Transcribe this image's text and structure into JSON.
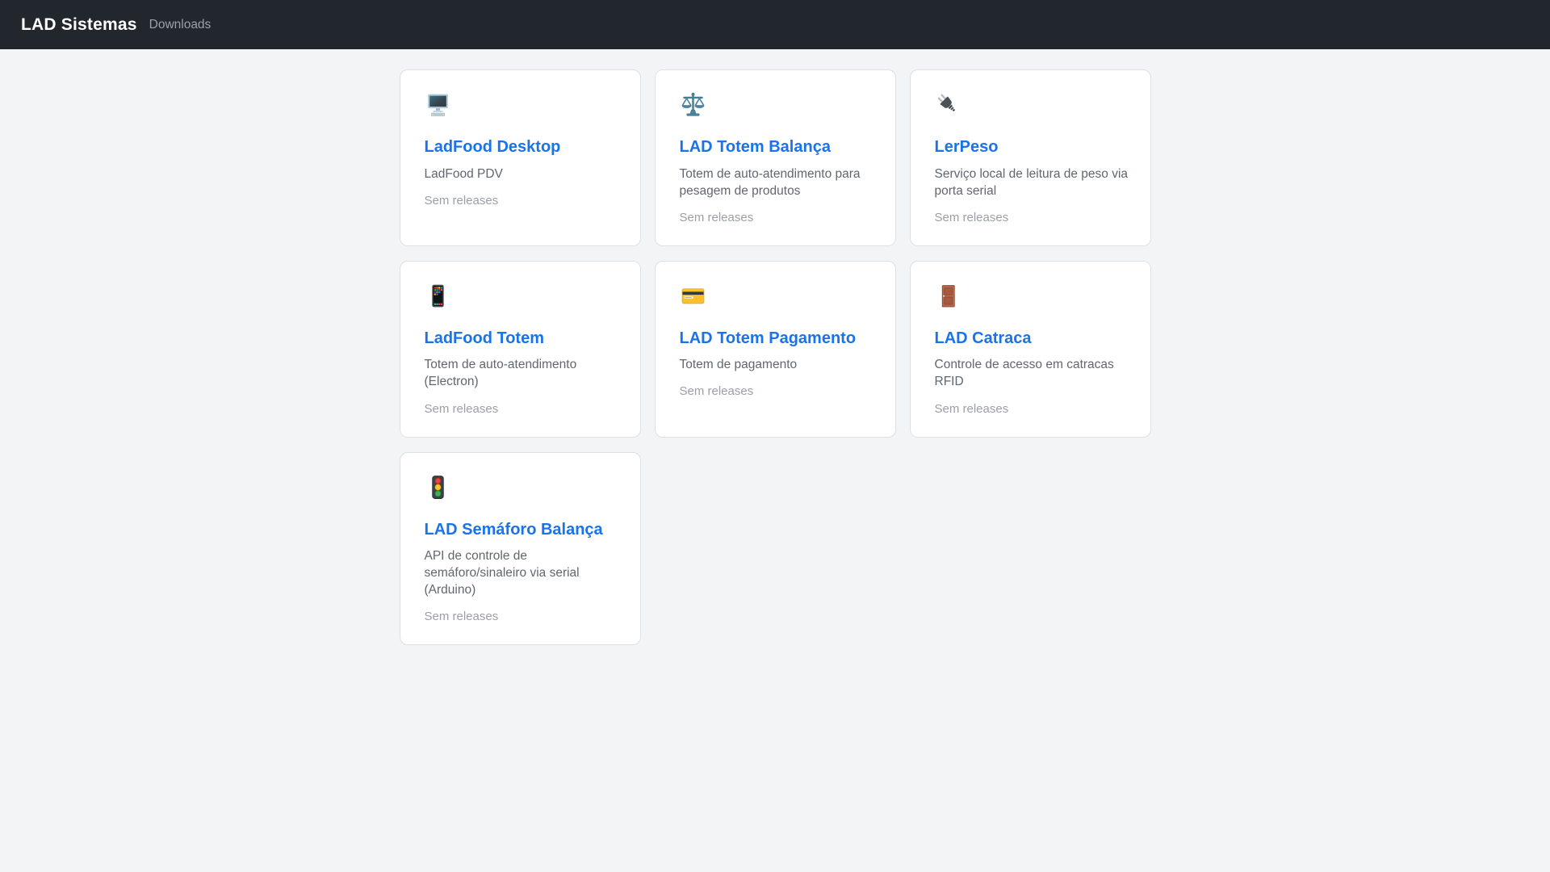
{
  "header": {
    "brand": "LAD Sistemas",
    "nav": [
      {
        "label": "Downloads"
      }
    ]
  },
  "colors": {
    "header_bg": "#22272e",
    "page_bg": "#f3f4f6",
    "accent_blue": "#1a73e8"
  },
  "cards": [
    {
      "title": "LadFood Desktop",
      "description": "LadFood PDV",
      "releases": "Sem releases",
      "icon": "desktop-computer"
    },
    {
      "title": "LAD Totem Balança",
      "description": "Totem de auto-atendimento para pesagem de produtos",
      "releases": "Sem releases",
      "icon": "balance-scale"
    },
    {
      "title": "LerPeso",
      "description": "Serviço local de leitura de peso via porta serial",
      "releases": "Sem releases",
      "icon": "electric-plug"
    },
    {
      "title": "LadFood Totem",
      "description": "Totem de auto-atendimento (Electron)",
      "releases": "Sem releases",
      "icon": "mobile-phone"
    },
    {
      "title": "LAD Totem Pagamento",
      "description": "Totem de pagamento",
      "releases": "Sem releases",
      "icon": "credit-card"
    },
    {
      "title": "LAD Catraca",
      "description": "Controle de acesso em catracas RFID",
      "releases": "Sem releases",
      "icon": "door"
    },
    {
      "title": "LAD Semáforo Balança",
      "description": "API de controle de semáforo/sinaleiro via serial (Arduino)",
      "releases": "Sem releases",
      "icon": "traffic-light"
    }
  ]
}
